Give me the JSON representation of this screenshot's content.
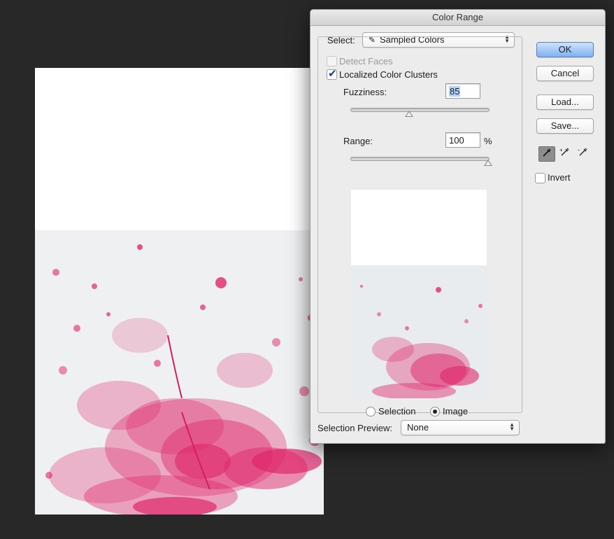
{
  "dialog": {
    "title": "Color Range",
    "select_label": "Select:",
    "select_value": "Sampled Colors",
    "detect_faces_label": "Detect Faces",
    "detect_faces_checked": false,
    "localized_clusters_label": "Localized Color Clusters",
    "localized_clusters_checked": true,
    "fuzziness_label": "Fuzziness:",
    "fuzziness_value": "85",
    "fuzziness_slider_fraction": 0.425,
    "range_label": "Range:",
    "range_value": "100",
    "range_unit": "%",
    "range_slider_fraction": 1.0,
    "radio_selection_label": "Selection",
    "radio_image_label": "Image",
    "radio_selected": "Image",
    "selection_preview_label": "Selection Preview:",
    "selection_preview_value": "None",
    "buttons": {
      "ok": "OK",
      "cancel": "Cancel",
      "load": "Load...",
      "save": "Save..."
    },
    "invert_label": "Invert",
    "invert_checked": false,
    "tools": [
      "eyedropper-icon",
      "eyedropper-plus-icon",
      "eyedropper-minus-icon"
    ]
  },
  "colors": {
    "background": "#282828",
    "splash": "#e0276b",
    "default_button": "#7fb1f1"
  }
}
